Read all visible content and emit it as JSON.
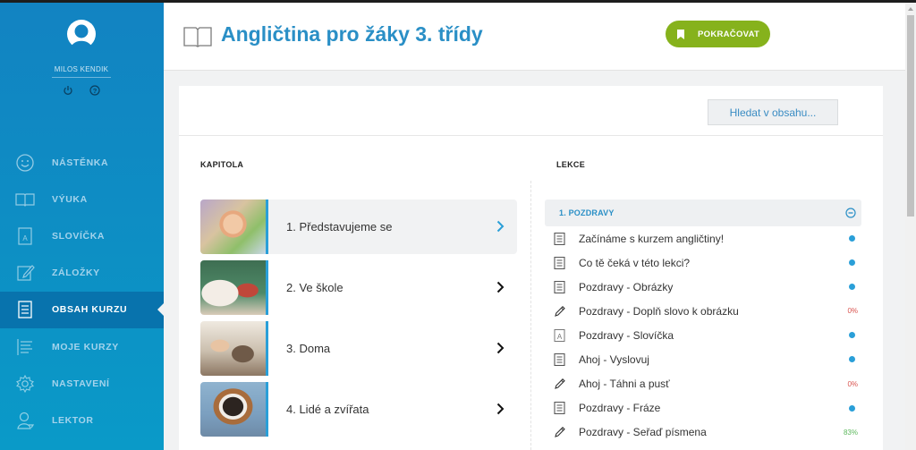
{
  "user": {
    "name": "MILOS KENDIK"
  },
  "nav": [
    {
      "label": "NÁSTĚNKA",
      "icon": "smiley-icon"
    },
    {
      "label": "VÝUKA",
      "icon": "book-icon"
    },
    {
      "label": "SLOVÍČKA",
      "icon": "dictionary-icon"
    },
    {
      "label": "ZÁLOŽKY",
      "icon": "edit-note-icon"
    },
    {
      "label": "OBSAH KURZU",
      "icon": "document-list-icon",
      "active": true
    },
    {
      "label": "MOJE KURZY",
      "icon": "list-icon"
    },
    {
      "label": "NASTAVENÍ",
      "icon": "gear-icon"
    },
    {
      "label": "LEKTOR",
      "icon": "person-icon"
    }
  ],
  "header": {
    "title": "Angličtina pro žáky 3. třídy",
    "continue_label": "POKRAČOVAT"
  },
  "search": {
    "label": "Hledat v obsahu..."
  },
  "columns": {
    "chapters_label": "KAPITOLA",
    "lessons_label": "LEKCE"
  },
  "chapters": [
    {
      "label": "1. Představujeme se",
      "active": true
    },
    {
      "label": "2. Ve škole"
    },
    {
      "label": "3. Doma"
    },
    {
      "label": "4. Lidé a zvířata"
    }
  ],
  "section": {
    "label": "1. POZDRAVY"
  },
  "lessons": [
    {
      "label": "Začínáme s kurzem angličtiny!",
      "icon": "document-icon",
      "status": "dot"
    },
    {
      "label": "Co tě čeká v této lekci?",
      "icon": "document-icon",
      "status": "dot"
    },
    {
      "label": "Pozdravy - Obrázky",
      "icon": "document-icon",
      "status": "dot"
    },
    {
      "label": "Pozdravy - Doplň slovo k obrázku",
      "icon": "pencil-icon",
      "status": "percent",
      "percent": "0%"
    },
    {
      "label": "Pozdravy - Slovíčka",
      "icon": "dictionary-icon",
      "status": "dot"
    },
    {
      "label": "Ahoj - Vyslovuj",
      "icon": "document-icon",
      "status": "dot"
    },
    {
      "label": "Ahoj - Táhni a pusť",
      "icon": "pencil-icon",
      "status": "percent",
      "percent": "0%"
    },
    {
      "label": "Pozdravy - Fráze",
      "icon": "document-icon",
      "status": "dot"
    },
    {
      "label": "Pozdravy - Seřaď písmena",
      "icon": "pencil-icon",
      "status": "percent",
      "percent": "83%"
    }
  ],
  "colors": {
    "sidebar": "#0d8fc4",
    "accent": "#2a8fc6",
    "continue": "#86b21c",
    "dot": "#2a9fd8",
    "percent_zero": "#d9534f",
    "percent_progress": "#5cb85c"
  }
}
